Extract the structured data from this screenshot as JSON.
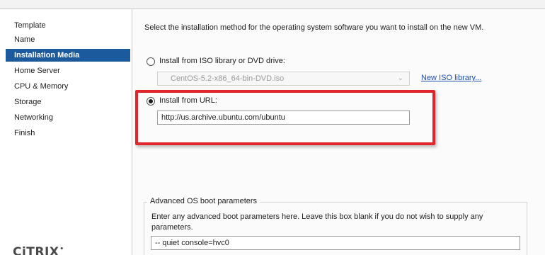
{
  "sidebar": {
    "items": [
      {
        "label": "Template",
        "active": false
      },
      {
        "label": "Name",
        "active": false
      },
      {
        "label": "Installation Media",
        "active": true
      },
      {
        "label": "Home Server",
        "active": false
      },
      {
        "label": "CPU & Memory",
        "active": false
      },
      {
        "label": "Storage",
        "active": false
      },
      {
        "label": "Networking",
        "active": false
      },
      {
        "label": "Finish",
        "active": false
      }
    ],
    "brand": "CiTRIX"
  },
  "main": {
    "instruction": "Select the installation method for the operating system software you want to install on the new VM.",
    "iso_option": {
      "label": "Install from ISO library or DVD drive:",
      "selected": false,
      "dropdown_value": "CentOS-5.2-x86_64-bin-DVD.iso",
      "link": "New ISO library..."
    },
    "url_option": {
      "label": "Install from URL:",
      "selected": true,
      "value": "http://us.archive.ubuntu.com/ubuntu"
    },
    "advanced": {
      "title": "Advanced OS boot parameters",
      "description_line1": "Enter any advanced boot parameters here. Leave this box blank if you do not wish to supply any",
      "description_line2": "parameters.",
      "value": "-- quiet console=hvc0"
    }
  },
  "colors": {
    "active_nav": "#1c5a9e",
    "highlight": "#e1252a",
    "link": "#1b4fb0"
  }
}
